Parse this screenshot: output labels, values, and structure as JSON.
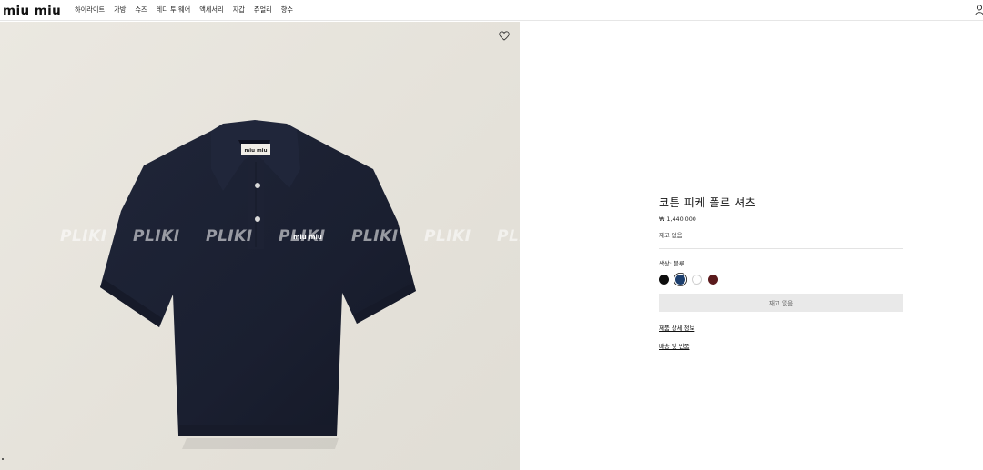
{
  "brand": {
    "logo": "miu miu"
  },
  "nav": [
    "하이라이트",
    "가방",
    "슈즈",
    "레디 투 웨어",
    "액세서리",
    "지갑",
    "쥬얼리",
    "향수"
  ],
  "icons": {
    "user": "user-icon",
    "wishlist": "heart-icon"
  },
  "image": {
    "watermark": "PLIKI",
    "collar_tag": "miu miu",
    "chest_logo": "miu miu"
  },
  "product": {
    "title": "코튼 피케 폴로 셔츠",
    "price": "₩ 1,440,000",
    "stock_status": "재고 없음",
    "color_label": "색상:",
    "color_value": "블루",
    "swatches": [
      {
        "name": "black",
        "hex": "#0d0d0d"
      },
      {
        "name": "blue",
        "hex": "#1d3f6e",
        "selected": true
      },
      {
        "name": "white",
        "hex": "#ffffff"
      },
      {
        "name": "burgundy",
        "hex": "#5a1a1c"
      }
    ],
    "cta_label": "재고 없음",
    "details_link": "제품 상세 정보",
    "shipping_link": "배송 및 반품"
  },
  "colors": {
    "shirt": "#1b2032",
    "background": "#e8e5de"
  }
}
